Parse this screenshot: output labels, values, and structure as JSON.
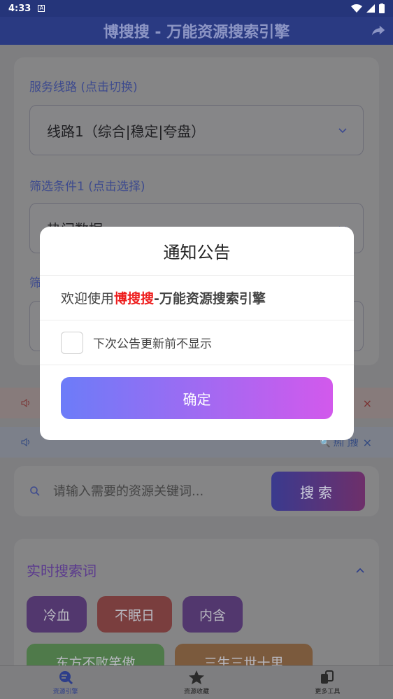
{
  "status": {
    "time": "4:33",
    "badge": "A"
  },
  "appbar": {
    "title": "博搜搜 - 万能资源搜索引擎"
  },
  "form": {
    "route_label": "服务线路 (点击切换)",
    "route_value": "线路1（综合|稳定|夸盘）",
    "filter1_label": "筛选条件1 (点击选择)",
    "filter1_value": "热门数据",
    "filter2_label_partial": "筛"
  },
  "notices": [
    {
      "text": "",
      "close": "×"
    },
    {
      "text": "🔍 热门搜",
      "close": "×"
    }
  ],
  "search": {
    "placeholder": "请输入需要的资源关键词...",
    "button": "搜索"
  },
  "hot": {
    "title": "实时搜索词",
    "chips": [
      "冷血",
      "不眠日",
      "内含",
      "东方不败笑傲",
      "三生三世十里"
    ]
  },
  "nav": [
    {
      "label": "资源引擎"
    },
    {
      "label": "资源收藏"
    },
    {
      "label": "更多工具"
    }
  ],
  "modal": {
    "title": "通知公告",
    "welcome_prefix": "欢迎使用",
    "brand": "博搜搜",
    "welcome_suffix": "-万能资源搜索引擎",
    "checkbox_label": "下次公告更新前不显示",
    "ok": "确定"
  },
  "colors": {
    "primary": "#2a3a82",
    "brand_red": "#ee1c1c",
    "button_start": "#6c7cf8",
    "button_end": "#d259ec"
  }
}
